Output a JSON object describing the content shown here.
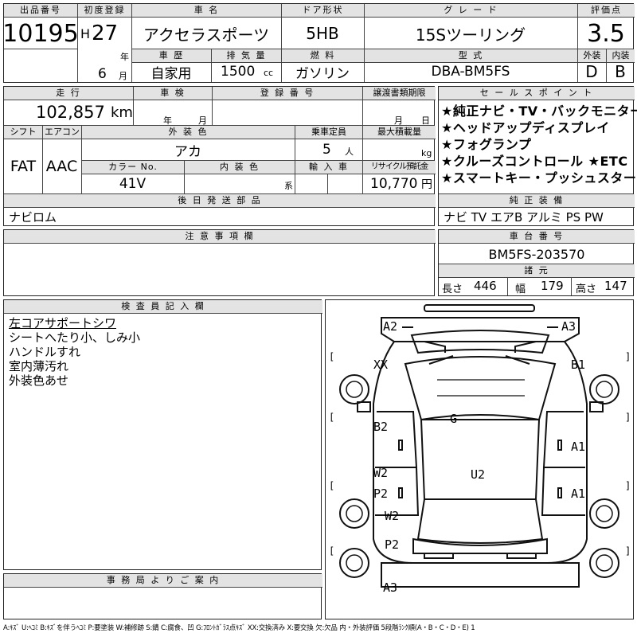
{
  "top": {
    "lot_no": {
      "label": "出品番号",
      "value": "10195"
    },
    "first_reg": {
      "label": "初度登録",
      "era": "H",
      "year": "27",
      "year_unit": "年",
      "month": "6",
      "month_unit": "月"
    },
    "car_name": {
      "label": "車 名",
      "value": "アクセラスポーツ"
    },
    "door": {
      "label": "ドア形状",
      "value": "5HB"
    },
    "grade": {
      "label": "グ レ ー ド",
      "value": "15Sツーリング"
    },
    "score": {
      "label": "評価点",
      "value": "3.5"
    },
    "history": {
      "label": "車 歴",
      "value": "自家用"
    },
    "displacement": {
      "label": "排 気 量",
      "value": "1500",
      "unit": "cc"
    },
    "fuel": {
      "label": "燃 料",
      "value": "ガソリン"
    },
    "model": {
      "label": "型 式",
      "value": "DBA-BM5FS"
    },
    "exterior_grade": {
      "label": "外装",
      "value": "D"
    },
    "interior_grade": {
      "label": "内装",
      "value": "B"
    }
  },
  "mid": {
    "mileage": {
      "label": "走 行",
      "value": "102,857",
      "unit": "km"
    },
    "inspection": {
      "label": "車 検",
      "year_unit": "年",
      "month_unit": "月"
    },
    "reg_no": {
      "label": "登 録 番 号"
    },
    "transfer_date": {
      "label": "譲渡書類期限",
      "month_unit": "月",
      "day_unit": "日"
    },
    "shift": {
      "label": "シフト",
      "value": "FAT"
    },
    "aircon": {
      "label": "エアコン",
      "value": "AAC"
    },
    "ext_color": {
      "label": "外 装 色",
      "value": "アカ"
    },
    "capacity": {
      "label": "乗車定員",
      "value": "5",
      "unit": "人"
    },
    "max_load": {
      "label": "最大積載量",
      "unit": "kg"
    },
    "color_no": {
      "label": "カラー No.",
      "value": "41V"
    },
    "int_color": {
      "label": "内 装 色",
      "unit": "系"
    },
    "import": {
      "label": "輸 入 車"
    },
    "recycle": {
      "label": "リサイクル預託金",
      "value": "10,770",
      "unit": "円"
    },
    "sales_points": {
      "label": "セ ー ル ス ポ イ ン ト",
      "lines": [
        "★純正ナビ・TV・バックモニター",
        "★ヘッドアップディスプレイ",
        "★フォグランプ",
        "★クルーズコントロール ★ETC",
        "★スマートキー・プッシュスタート"
      ]
    },
    "later_parts": {
      "label": "後 日 発 送 部 品",
      "value": "ナビロム"
    },
    "genuine_equip": {
      "label": "純 正 装 備",
      "value": "ナビ TV エアB アルミ PS PW"
    }
  },
  "notes": {
    "label": "注 意 事 項 欄"
  },
  "chassis": {
    "label": "車 台 番 号",
    "value": "BM5FS-203570",
    "dims_label": "諸 元",
    "length_label": "長さ",
    "length": "446",
    "width_label": "幅",
    "width": "179",
    "height_label": "高さ",
    "height": "147"
  },
  "inspector": {
    "label": "検 査 員 記 入 欄",
    "lines": [
      "左コアサポートシワ",
      "シートへたり小、しみ小",
      "ハンドルすれ",
      "室内薄汚れ",
      "外装色あせ"
    ]
  },
  "office": {
    "label": "事 務 局 よ り ご 案 内"
  },
  "diagram": {
    "marks": {
      "front_left": "A2",
      "front_right": "A3",
      "left_fender": "XX",
      "right_fender": "B1",
      "left_front_door": "B2",
      "right_front_door": "A1",
      "roof_glass": "G",
      "left_rear_door_w": "W2",
      "left_rear_door_p": "P2",
      "right_rear_door": "A1",
      "roof": "U2",
      "left_quarter_w": "W2",
      "left_quarter_p": "P2",
      "rear_bumper": "A3"
    },
    "brackets": [
      "[",
      "]",
      "[",
      "]",
      "[",
      "]",
      "[",
      "]"
    ]
  },
  "legend": "A:ｷｽﾞ U:ﾍｺﾐ B:ｷｽﾞを伴うﾍｺﾐ P:要塗装 W:補修跡 S:錆 C:腐食、凹 G:ﾌﾛﾝﾄｶﾞﾗｽ点ｷｽﾞ XX:交換済み X:要交換 欠:欠品 内・外装評価 5段階ﾗﾝｸ順(A・B・C・D・E) 1"
}
